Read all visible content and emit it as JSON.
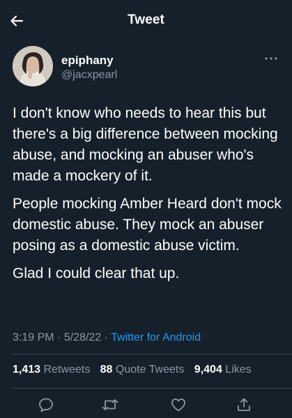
{
  "header": {
    "title": "Tweet"
  },
  "author": {
    "display_name": "epiphany",
    "handle": "@jacxpearl"
  },
  "tweet": {
    "paragraphs": [
      "I don't know who needs to hear this but there's a big difference between mocking abuse, and mocking an abuser who's made a mockery of it.",
      "People mocking Amber Heard don't mock domestic abuse. They mock an abuser posing as a domestic abuse victim.",
      "Glad I could clear that up."
    ]
  },
  "meta": {
    "time": "3:19 PM",
    "separator": "·",
    "date": "5/28/22",
    "source": "Twitter for Android"
  },
  "stats": {
    "retweets_count": "1,413",
    "retweets_label": "Retweets",
    "quote_count": "88",
    "quote_label": "Quote Tweets",
    "likes_count": "9,404",
    "likes_label": "Likes"
  },
  "icons": {
    "back": "arrow-left-icon",
    "more": "more-horizontal-icon",
    "reply": "reply-icon",
    "retweet": "retweet-icon",
    "like": "heart-icon",
    "share": "share-icon"
  },
  "colors": {
    "background": "#15202b",
    "text_primary": "#ffffff",
    "text_secondary": "#8b98a5",
    "link": "#1d9bf0",
    "divider": "#38444d"
  }
}
